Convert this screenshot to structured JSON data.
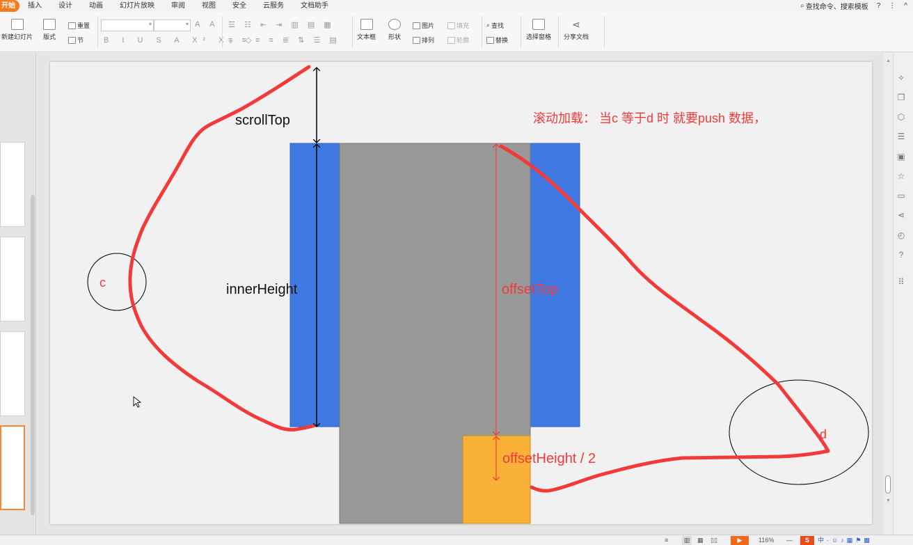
{
  "menu": {
    "tabs": [
      "开始",
      "插入",
      "设计",
      "动画",
      "幻灯片放映",
      "审阅",
      "视图",
      "安全",
      "云服务",
      "文档助手"
    ],
    "search_label": "查找命令、搜索模板",
    "help": "?",
    "more": "⋮",
    "collapse": "^"
  },
  "ribbon": {
    "new_slide": "新建幻灯片",
    "layout": "版式",
    "reset": "重置",
    "section": "节",
    "textbox": "文本框",
    "shape": "形状",
    "picture": "图片",
    "fill": "填充",
    "arrange": "排列",
    "outline": "轮廓",
    "find": "查找",
    "replace": "替换",
    "selection_pane": "选择窗格",
    "share_doc": "分享文档",
    "font_format": "B I U S A X² X₂ ◇"
  },
  "slide": {
    "title": "滚动加载： 当c 等于d 时 就要push 数据，",
    "scroll_top": "scrollTop",
    "inner_height": "innerHeight",
    "offset_top": "offsetTop",
    "offset_height": "offsetHeight / 2",
    "label_c": "c",
    "label_d": "d",
    "colors": {
      "blue": "#3f78e0",
      "gray": "#999999",
      "orange": "#f9b137",
      "red": "#f23a3a"
    }
  },
  "statusbar": {
    "zoom": "116%",
    "minus": "—"
  }
}
